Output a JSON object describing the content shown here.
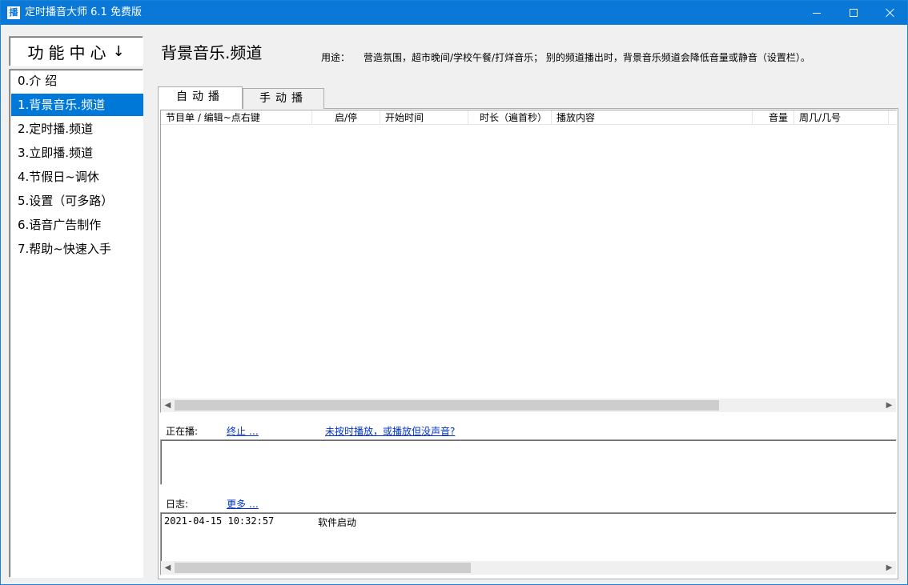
{
  "window": {
    "title": "定时播音大师 6.1 免费版",
    "icon_char": "播"
  },
  "sidebar": {
    "header": "功能中心",
    "items": [
      {
        "label": "0.介 绍"
      },
      {
        "label": "1.背景音乐.频道"
      },
      {
        "label": "2.定时播.频道"
      },
      {
        "label": "3.立即播.频道"
      },
      {
        "label": "4.节假日~调休"
      },
      {
        "label": "5.设置（可多路）"
      },
      {
        "label": "6.语音广告制作"
      },
      {
        "label": "7.帮助~快速入手"
      }
    ],
    "selected_index": 1
  },
  "main": {
    "title": "背景音乐.频道",
    "usage_label": "用途：",
    "usage_text": "营造氛围，超市晚间/学校午餐/打烊音乐；  别的频道播出时，背景音乐频道会降低音量或静音（设置栏）。",
    "tabs": [
      {
        "label": "自动播"
      },
      {
        "label": "手动播"
      }
    ],
    "grid": {
      "columns": [
        "节目单  / 编辑~点右键",
        "启/停",
        "开始时间",
        "时长（遍首秒）",
        "播放内容",
        "音量",
        "周几/几号"
      ],
      "rows": []
    },
    "now_playing": {
      "label": "正在播:",
      "stop_link": "终止 …",
      "help_link": "未按时播放，或播放但没声音?"
    },
    "log": {
      "label": "日志:",
      "more_link": "更多 …",
      "entries": [
        {
          "time": "2021-04-15 10:32:57",
          "message": "软件启动"
        }
      ]
    }
  }
}
